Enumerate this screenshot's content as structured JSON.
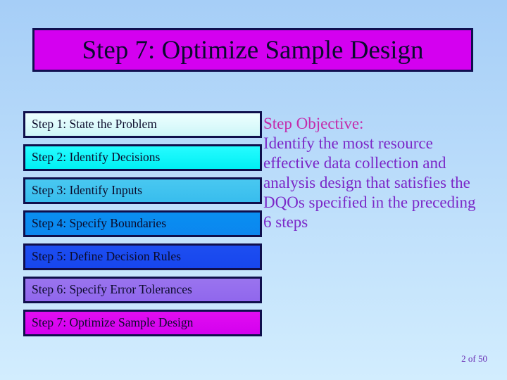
{
  "slide": {
    "title": "Step 7: Optimize Sample Design",
    "background_top_color": "#a6cef7",
    "background_bottom_color": "#d2edfe",
    "title_fill_color": "#d400f0",
    "title_border_color": "#101050",
    "title_text_color": "#0b0b2e"
  },
  "steps": [
    {
      "label": "Step 1: State the Problem",
      "fill_start": "#eeffff",
      "fill_end": "#cdf6f8"
    },
    {
      "label": "Step 2: Identify Decisions",
      "fill_start": "#27fbff",
      "fill_end": "#00f0f4"
    },
    {
      "label": "Step 3: Identify Inputs",
      "fill_start": "#49c8f0",
      "fill_end": "#38bdee"
    },
    {
      "label": "Step 4: Specify Boundaries",
      "fill_start": "#0a8ff0",
      "fill_end": "#0b86ef"
    },
    {
      "label": "Step 5: Define Decision Rules",
      "fill_start": "#1d4ef0",
      "fill_end": "#1746ee"
    },
    {
      "label": "Step 6: Specify Error Tolerances",
      "fill_start": "#9a74ee",
      "fill_end": "#9067ed"
    },
    {
      "label": "Step 7: Optimize Sample Design",
      "fill_start": "#e10ef0",
      "fill_end": "#d400ef"
    }
  ],
  "objective": {
    "heading": "Step Objective:",
    "body": "Identify the most resource effective data collection and analysis design that satisfies the DQOs specified in the preceding 6 steps",
    "heading_color": "#c42bab",
    "body_color": "#7b28c8"
  },
  "footer": {
    "page_label": "2 of 50",
    "page_color": "#6b2fb5"
  }
}
